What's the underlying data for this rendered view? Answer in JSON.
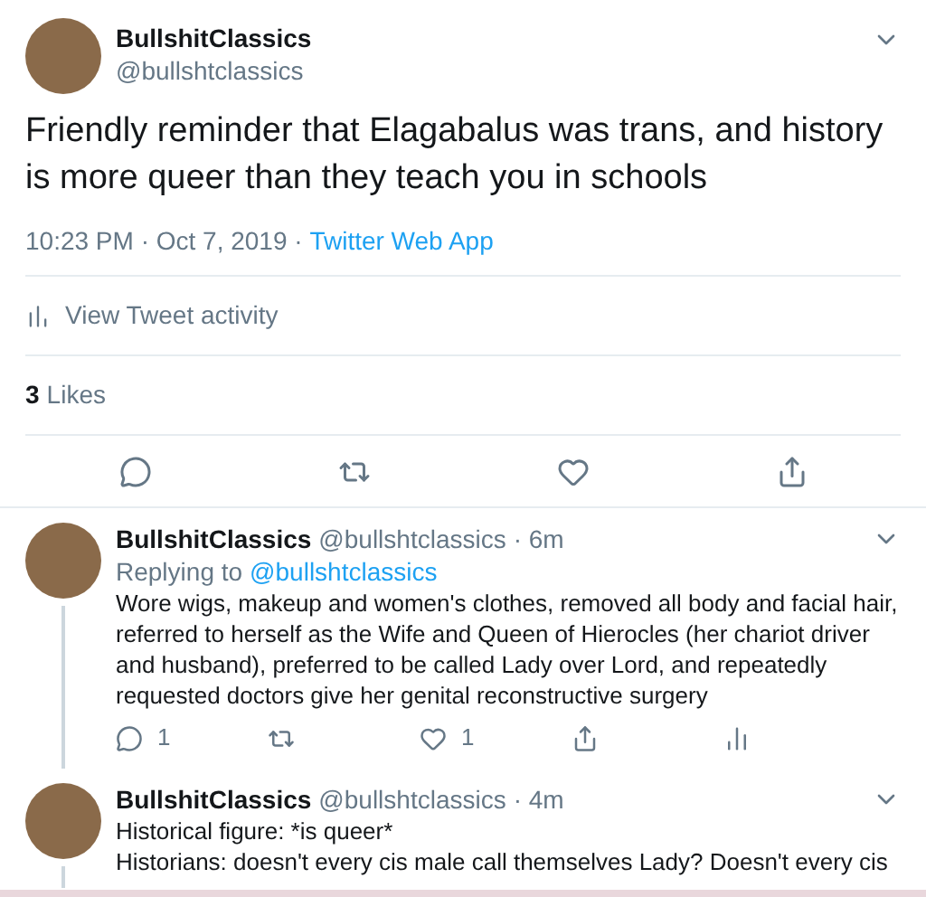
{
  "main_tweet": {
    "display_name": "BullshitClassics",
    "handle": "@bullshtclassics",
    "text": "Friendly reminder that Elagabalus was trans, and history is more queer than they teach you in schools",
    "timestamp": "10:23 PM · Oct 7, 2019 · ",
    "source": "Twitter Web App",
    "activity_link": "View Tweet activity",
    "likes_count": "3",
    "likes_label": "Likes",
    "actions": [
      {
        "kind": "reply"
      },
      {
        "kind": "retweet"
      },
      {
        "kind": "like"
      },
      {
        "kind": "share"
      }
    ]
  },
  "replies": [
    {
      "display_name": "BullshitClassics",
      "handle": "@bullshtclassics",
      "time": "· 6m",
      "replying_to_label": "Replying to",
      "replying_to_handle": "@bullshtclassics",
      "text_lines": [
        "Wore wigs, makeup and women's clothes, removed all body and facial hair, referred to herself as the Wife and Queen of Hierocles (her chariot driver and husband), preferred to be called Lady over Lord, and repeatedly requested doctors give her genital reconstructive surgery"
      ],
      "thread_continues": true,
      "actions": [
        {
          "kind": "reply",
          "count": "1"
        },
        {
          "kind": "retweet"
        },
        {
          "kind": "like",
          "count": "1"
        },
        {
          "kind": "share"
        },
        {
          "kind": "analytics"
        }
      ]
    },
    {
      "display_name": "BullshitClassics",
      "handle": "@bullshtclassics",
      "time": "· 4m",
      "text_lines": [
        "Historical figure: *is queer*",
        "Historians: doesn't every cis male call themselves Lady? Doesn't every cis"
      ],
      "thread_continues": true
    }
  ]
}
